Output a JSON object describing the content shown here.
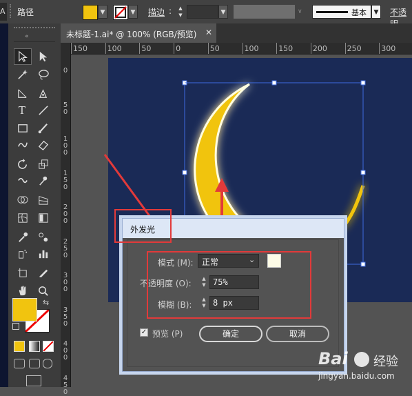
{
  "control_bar": {
    "object_label": "路径",
    "fill_color": "#f1c40f",
    "stroke_label": "描边",
    "stroke_style_label": "基本",
    "opacity_label": "不透明"
  },
  "document": {
    "tab_title": "未标题-1.ai* @ 100% (RGB/预览)",
    "close_symbol": "✕"
  },
  "rulers": {
    "top_ticks": [
      "150",
      "100",
      "50",
      "0",
      "50",
      "100",
      "150",
      "200",
      "250",
      "300"
    ],
    "left_ticks": [
      "0",
      "5\n0",
      "1\n0\n0",
      "1\n5\n0",
      "2\n0\n0",
      "2\n5\n0",
      "3\n0\n0",
      "3\n5\n0",
      "4\n0\n0",
      "4\n5\n0"
    ]
  },
  "artwork": {
    "background_color": "#1a2a56",
    "moon_color": "#f1c40f",
    "glow_color": "#fffde0"
  },
  "dialog": {
    "title": "外发光",
    "mode_label": "模式 (M):",
    "mode_value": "正常",
    "glow_color": "#fdfbe6",
    "opacity_label": "不透明度 (O):",
    "opacity_value": "75%",
    "blur_label": "模糊 (B):",
    "blur_value": "8 px",
    "preview_label": "预览 (P)",
    "preview_checked": true,
    "ok_label": "确定",
    "cancel_label": "取消"
  },
  "toolbar": {
    "fill_color": "#f1c40f",
    "stroke_color": "#ffffff"
  },
  "watermark": {
    "logo_text": "Bai",
    "logo_suffix": "经验",
    "url": "jingyan.baidu.com"
  }
}
